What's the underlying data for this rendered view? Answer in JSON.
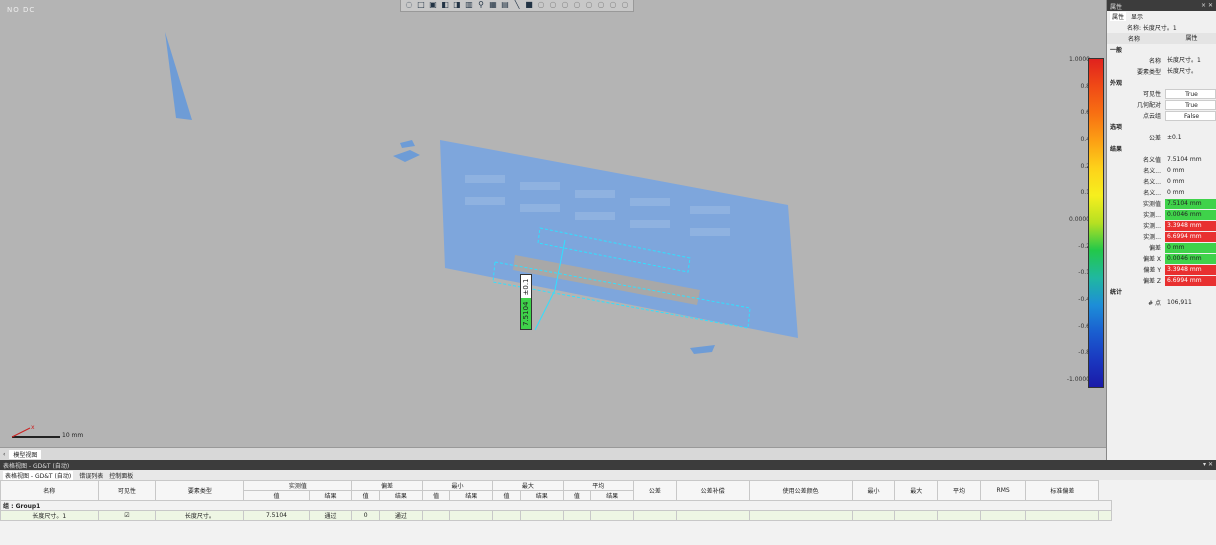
{
  "toolbar": {
    "icons": [
      "select-icon",
      "cube-icon",
      "view-front-icon",
      "view-side-icon",
      "view-top-icon",
      "view-iso-icon",
      "align-icon",
      "grid-icon",
      "table-icon",
      "line-icon",
      "fill-icon",
      "circle-icon",
      "circle-icon",
      "circle-icon",
      "circle-icon",
      "circle-icon",
      "circle-icon",
      "circle-icon",
      "circle-icon"
    ]
  },
  "viewport": {
    "corner_text": "NO DC",
    "scalebar_label": "10 mm",
    "axis_label": "x"
  },
  "measurement": {
    "value": "7.5104",
    "tolerance": "±0.1"
  },
  "colorscale": {
    "labels": [
      "1.0000",
      "0.8",
      "0.6",
      "0.4",
      "0.2",
      "0.1",
      "0.0000",
      "-0.2",
      "-0.1",
      "-0.4",
      "-0.6",
      "-0.8",
      "-1.0000"
    ],
    "colors": [
      "#e0221e",
      "#f04a16",
      "#f87012",
      "#fca014",
      "#fdd21a",
      "#f6ef1e",
      "#b6e022",
      "#22c84a",
      "#20b8a0",
      "#1d8ed8",
      "#1a5ed0",
      "#1a38c0",
      "#1a1aa8"
    ]
  },
  "props": {
    "title": "属性",
    "tab_props": "属性",
    "tab_display": "显示",
    "name_prefix": "名称: 长度尺寸。1",
    "col_name": "名称",
    "col_prop": "属性",
    "rows": [
      {
        "type": "sec",
        "k": "一般"
      },
      {
        "type": "row",
        "k": "名称",
        "v": "长度尺寸。1"
      },
      {
        "type": "row",
        "k": "要素类型",
        "v": "长度尺寸。"
      },
      {
        "type": "sec",
        "k": "外观"
      },
      {
        "type": "row",
        "k": "可见性",
        "v": "True",
        "box": true
      },
      {
        "type": "row",
        "k": "几何配对",
        "v": "True",
        "box": true
      },
      {
        "type": "row",
        "k": "点云组",
        "v": "False",
        "box": true
      },
      {
        "type": "sec",
        "k": "选项"
      },
      {
        "type": "row",
        "k": "公差",
        "v": "±0.1"
      },
      {
        "type": "sec",
        "k": "结果"
      },
      {
        "type": "row",
        "k": "名义值",
        "v": "7.5104 mm"
      },
      {
        "type": "row",
        "k": "名义...",
        "v": "0 mm"
      },
      {
        "type": "row",
        "k": "名义...",
        "v": "0 mm"
      },
      {
        "type": "row",
        "k": "名义...",
        "v": "0 mm"
      },
      {
        "type": "row",
        "k": "实测值",
        "v": "7.5104 mm",
        "c": "green"
      },
      {
        "type": "row",
        "k": "实测...",
        "v": "0.0046 mm",
        "c": "green"
      },
      {
        "type": "row",
        "k": "实测...",
        "v": "3.3948 mm",
        "c": "red"
      },
      {
        "type": "row",
        "k": "实测...",
        "v": "6.6994 mm",
        "c": "red"
      },
      {
        "type": "row",
        "k": "偏差",
        "v": "0 mm",
        "c": "green"
      },
      {
        "type": "row",
        "k": "偏差 X",
        "v": "0.0046 mm",
        "c": "green"
      },
      {
        "type": "row",
        "k": "偏差 Y",
        "v": "3.3948 mm",
        "c": "red"
      },
      {
        "type": "row",
        "k": "偏差 Z",
        "v": "6.6994 mm",
        "c": "red"
      },
      {
        "type": "sec",
        "k": "统计"
      },
      {
        "type": "row",
        "k": "# 点",
        "v": "106,911"
      }
    ]
  },
  "viewtab": "模型视图",
  "bottom": {
    "title": "表格视图 - GD&T (自动)",
    "tab": "表格视图 - GD&T (自动)",
    "btn_error": "错误列表",
    "btn_control": "控制面板",
    "headers_top": [
      "名称",
      "可见性",
      "要素类型",
      "实测值",
      "偏差",
      "最小",
      "最大",
      "平均",
      "公差",
      "公差补偿",
      "使用公差颜色",
      "最小",
      "最大",
      "平均",
      "RMS",
      "标准偏差"
    ],
    "sub": [
      "值",
      "结果"
    ],
    "group": "组 : Group1",
    "row": {
      "name": "长度尺寸。1",
      "visible": "☑",
      "type": "长度尺寸。",
      "value": "7.5104",
      "result": "通过",
      "dev": "0",
      "dev_result": "通过"
    }
  }
}
